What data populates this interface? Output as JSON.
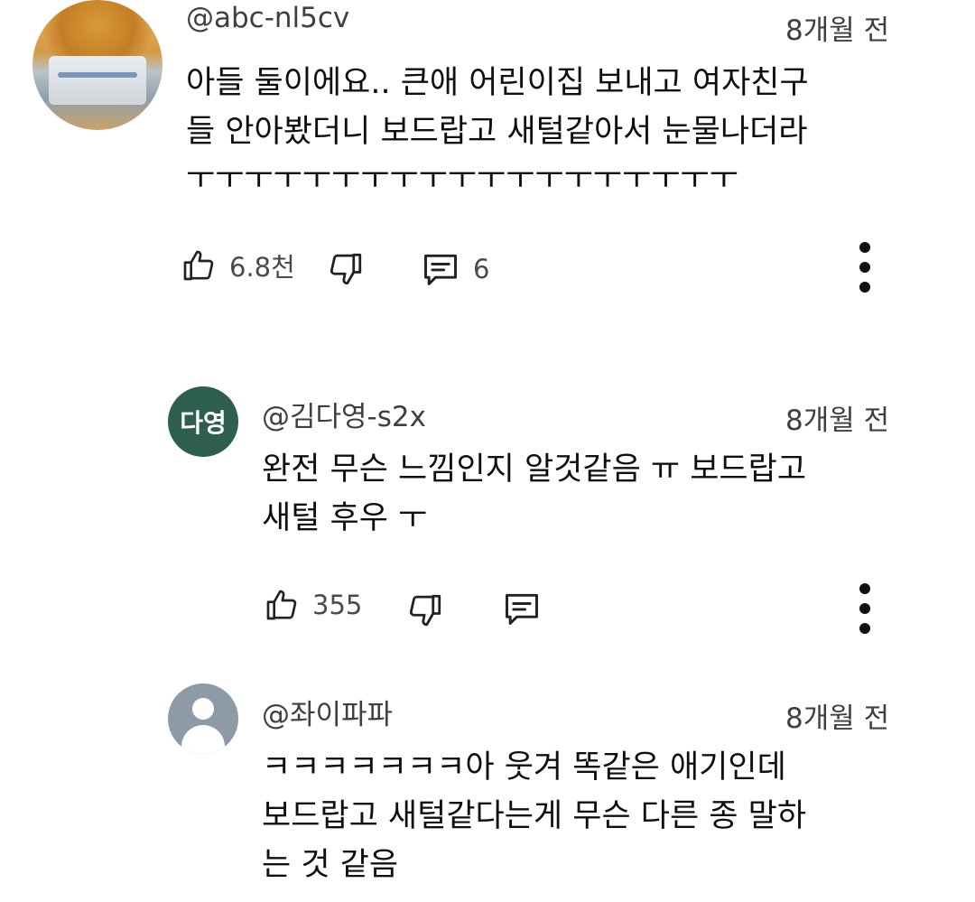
{
  "comments": [
    {
      "avatar_label": "",
      "handle": "@abc-nl5cv",
      "time": "8개월 전",
      "text_lines": [
        "아들 둘이에요.. 큰애 어린이집 보내고 여자친구",
        "들 안아봤더니 보드랍고 새털같아서 눈물나더라",
        "ㅜㅜㅜㅜㅜㅜㅜㅜㅜㅜㅜㅜㅜㅜㅜㅜㅜㅜㅜ"
      ],
      "like_count": "6.8천",
      "reply_count": "6"
    },
    {
      "avatar_label": "다영",
      "handle": "@김다영-s2x",
      "time": "8개월 전",
      "text_lines": [
        "완전 무슨 느낌인지 알것같음 ㅠ 보드랍고",
        "새털 후우 ㅜ"
      ],
      "like_count": "355",
      "reply_count": ""
    },
    {
      "avatar_label": "",
      "handle": "@좌이파파",
      "time": "8개월 전",
      "text_lines": [
        "ㅋㅋㅋㅋㅋㅋㅋ아 웃겨 똑같은 애기인데",
        "보드랍고 새털같다는게 무슨 다른 종 말하",
        "는 것 같음"
      ],
      "like_count": "",
      "reply_count": ""
    }
  ],
  "icons": {
    "like": "thumbs-up-icon",
    "dislike": "thumbs-down-icon",
    "reply": "comment-icon",
    "more": "more-vertical-icon"
  },
  "colors": {
    "text": "#0f0f0f",
    "meta": "#3f3f3f",
    "avatar2_bg": "#2e5e4c",
    "avatar3_bg": "#8e9aa6"
  }
}
